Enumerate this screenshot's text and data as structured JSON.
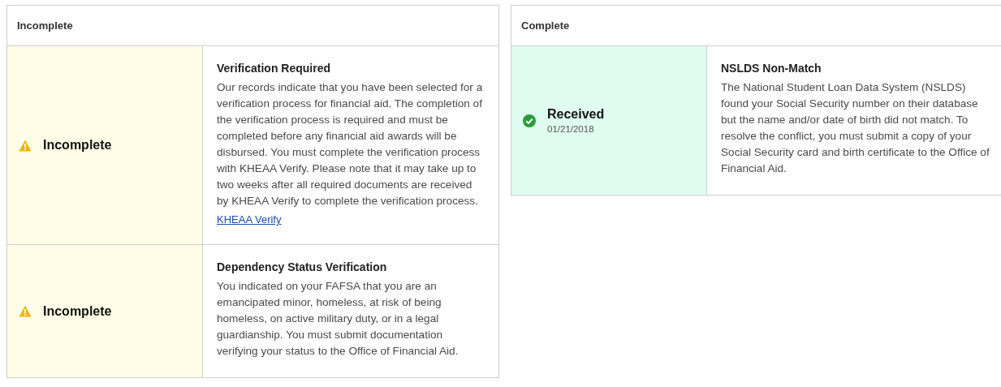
{
  "panels": [
    {
      "title": "Incomplete",
      "items": [
        {
          "status": {
            "kind": "incomplete",
            "label": "Incomplete"
          },
          "title": "Verification Required",
          "description": "Our records indicate that you have been selected for a verification process for financial aid. The completion of the verification process is required and must be completed before any financial aid awards will be disbursed. You must complete the verification process with KHEAA Verify. Please note that it may take up to two weeks after all required documents are received by KHEAA Verify to complete the verification process.",
          "link": "KHEAA Verify"
        },
        {
          "status": {
            "kind": "incomplete",
            "label": "Incomplete"
          },
          "title": "Dependency Status Verification",
          "description": "You indicated on your FAFSA that you are an emancipated minor, homeless, at risk of being homeless, on active military duty, or in a legal guardianship. You must submit documentation verifying your status to the Office of Financial Aid."
        }
      ]
    },
    {
      "title": "Complete",
      "items": [
        {
          "status": {
            "kind": "received",
            "label": "Received",
            "date": "01/21/2018"
          },
          "title": "NSLDS Non-Match",
          "description": "The National Student Loan Data System (NSLDS) found your Social Security number on their database but the name and/or date of birth did not match. To resolve the conflict, you must submit a copy of your Social Security card and birth certificate to the Office of Financial Aid."
        }
      ]
    }
  ]
}
